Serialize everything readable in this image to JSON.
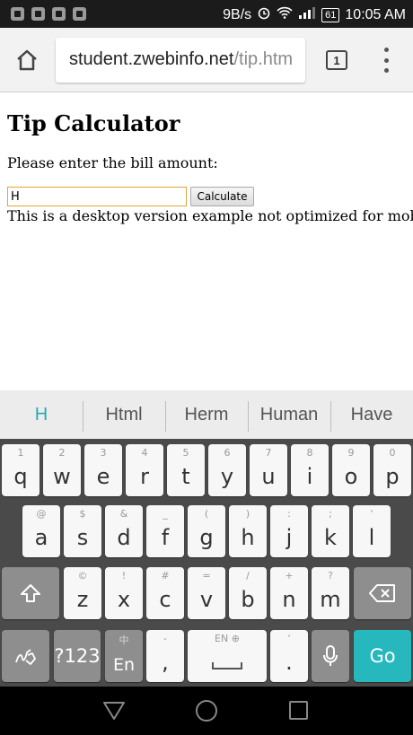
{
  "status_bar": {
    "speed": "9B/s",
    "battery": "61",
    "time": "10:05 AM"
  },
  "browser": {
    "url_host": "student.zwebinfo.net",
    "url_path": "/tip.htm",
    "tab_count": "1"
  },
  "page": {
    "title": "Tip Calculator",
    "prompt": "Please enter the bill amount:",
    "bill_input_value": "H",
    "calculate_label": "Calculate",
    "note": "This is a desktop version example not optimized for mobile"
  },
  "keyboard": {
    "suggestions": [
      "H",
      "Html",
      "Herm",
      "Human",
      "Have"
    ],
    "row1": [
      {
        "key": "q",
        "hint": "1"
      },
      {
        "key": "w",
        "hint": "2"
      },
      {
        "key": "e",
        "hint": "3"
      },
      {
        "key": "r",
        "hint": "4"
      },
      {
        "key": "t",
        "hint": "5"
      },
      {
        "key": "y",
        "hint": "6"
      },
      {
        "key": "u",
        "hint": "7"
      },
      {
        "key": "i",
        "hint": "8"
      },
      {
        "key": "o",
        "hint": "9"
      },
      {
        "key": "p",
        "hint": "0"
      }
    ],
    "row2": [
      {
        "key": "a",
        "hint": "@"
      },
      {
        "key": "s",
        "hint": "$"
      },
      {
        "key": "d",
        "hint": "&"
      },
      {
        "key": "f",
        "hint": "_"
      },
      {
        "key": "g",
        "hint": "("
      },
      {
        "key": "h",
        "hint": ")"
      },
      {
        "key": "j",
        "hint": ":"
      },
      {
        "key": "k",
        "hint": ";"
      },
      {
        "key": "l",
        "hint": "'"
      }
    ],
    "row3": [
      {
        "key": "z",
        "hint": "©"
      },
      {
        "key": "x",
        "hint": "!"
      },
      {
        "key": "c",
        "hint": "#"
      },
      {
        "key": "v",
        "hint": "="
      },
      {
        "key": "b",
        "hint": "/"
      },
      {
        "key": "n",
        "hint": "+"
      },
      {
        "key": "m",
        "hint": "?"
      }
    ],
    "symbols_label": "?123",
    "lang_label": "En",
    "lang_hint": "中",
    "comma_label": ",",
    "comma_hint": "-",
    "space_hint": "EN ⊕",
    "period_label": ".",
    "period_hint": "'",
    "go_label": "Go"
  },
  "icons": {
    "home": "home-icon",
    "tabs": "tab-switcher-icon",
    "menu": "overflow-menu-icon",
    "shift": "shift-icon",
    "backspace": "backspace-icon",
    "mic": "microphone-icon",
    "handwriting": "handwriting-icon",
    "back": "back-icon",
    "recent": "recent-apps-icon"
  },
  "colors": {
    "accent": "#26b8bd",
    "input_border": "#e2a43a"
  }
}
